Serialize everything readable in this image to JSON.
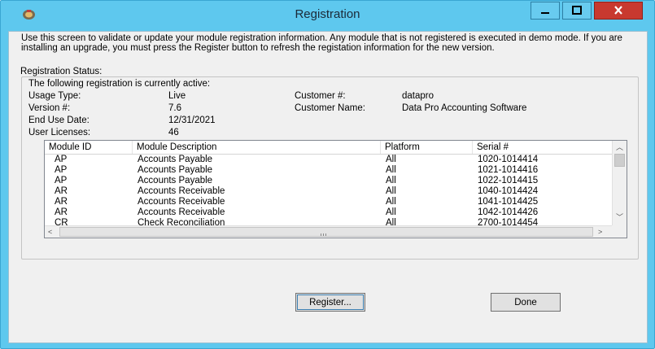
{
  "window": {
    "title": "Registration",
    "accent_color": "#5ec8ee",
    "close_color": "#c8392f"
  },
  "intro_text": "Use this screen to validate or update your module registration information. Any module that is not registered is executed in demo mode.  If you are installing an upgrade, you must press the Register button to refresh the registation information for the new version.",
  "group": {
    "title": "Registration Status:",
    "active_text": "The following registration is currently active:",
    "usage_type_label": "Usage Type:",
    "usage_type": "Live",
    "version_label": "Version #:",
    "version": "7.6",
    "end_use_date_label": "End Use Date:",
    "end_use_date": "12/31/2021",
    "user_licenses_label": "User Licenses:",
    "user_licenses": "46",
    "customer_number_label": "Customer #:",
    "customer_number": "datapro",
    "customer_name_label": "Customer Name:",
    "customer_name": "Data Pro Accounting Software"
  },
  "modules": {
    "columns": [
      "Module ID",
      "Module Description",
      "Platform",
      "Serial #"
    ],
    "rows": [
      [
        "AP",
        "Accounts Payable",
        "All",
        "1020-1014414"
      ],
      [
        "AP",
        "Accounts Payable",
        "All",
        "1021-1014416"
      ],
      [
        "AP",
        "Accounts Payable",
        "All",
        "1022-1014415"
      ],
      [
        "AR",
        "Accounts Receivable",
        "All",
        "1040-1014424"
      ],
      [
        "AR",
        "Accounts Receivable",
        "All",
        "1041-1014425"
      ],
      [
        "AR",
        "Accounts Receivable",
        "All",
        "1042-1014426"
      ],
      [
        "CR",
        "Check Reconciliation",
        "All",
        "2700-1014454"
      ]
    ]
  },
  "buttons": {
    "register": "Register...",
    "done": "Done"
  },
  "icons": {
    "app": "app-icon",
    "minimize": "minimize-icon",
    "maximize": "maximize-icon",
    "close": "close-icon"
  }
}
